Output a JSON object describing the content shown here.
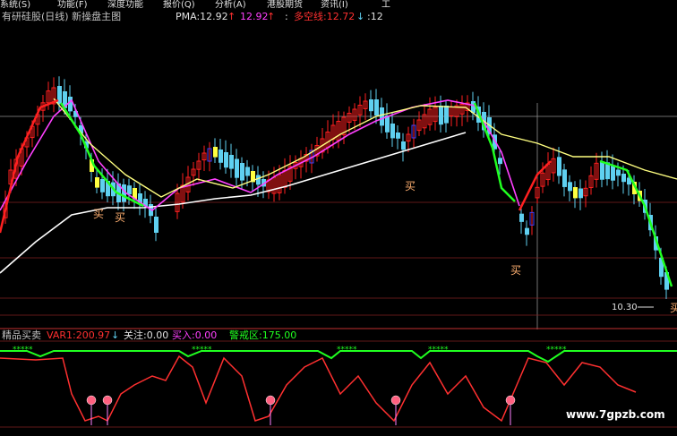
{
  "menu": {
    "items": [
      {
        "label": "系统(S)"
      },
      {
        "label": "功能(F)"
      },
      {
        "label": "深度功能"
      },
      {
        "label": "报价(Q)"
      },
      {
        "label": "分析(A)"
      },
      {
        "label": "港股期货"
      },
      {
        "label": "资讯(I)"
      },
      {
        "label": "工"
      }
    ]
  },
  "header": {
    "title": "有研硅股(日线) 新操盘主图",
    "pma_label": "PMA:12.92",
    "pma_arrow": "↑",
    "value2": "12.92",
    "value2_arrow": "↑",
    "sep": ":",
    "trend_label": "多空线:12.72",
    "trend_arrow": "↓",
    "trailing": ":12"
  },
  "main_chart": {
    "buy_signal_text": "买",
    "price_annotation": "10.30"
  },
  "sub_chart": {
    "name": "精品买卖",
    "var1": "VAR1:200.97",
    "var1_arrow": "↓",
    "watch": "关注:0.00",
    "buy_in": "买入:0.00",
    "alert": "警戒区:175.00"
  },
  "watermark": "www.7gpzb.com",
  "colors": {
    "bg": "#000000",
    "up": "#ff2020",
    "down": "#5fd0f0",
    "yellow_candle": "#ffff40",
    "blue_candle": "#4040ff",
    "pma": "#ffffff",
    "ma_magenta": "#ff40ff",
    "ma_yellow": "#ffff80",
    "ma_green": "#20ff20",
    "grid": "#802020",
    "alert_line": "#20ff20",
    "osc_line": "#ff3030"
  }
}
